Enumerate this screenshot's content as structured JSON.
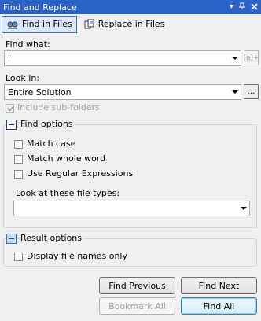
{
  "window": {
    "title": "Find and Replace"
  },
  "tabs": [
    {
      "label": "Find in Files"
    },
    {
      "label": "Replace in Files"
    }
  ],
  "find_what": {
    "label": "Find what:",
    "value": "i",
    "builder_label": "(a)+"
  },
  "look_in": {
    "label": "Look in:",
    "value": "Entire Solution",
    "browse_label": "..."
  },
  "include_subfolders": {
    "label": "Include sub-folders",
    "checked": true
  },
  "find_options": {
    "title": "Find options",
    "match_case": "Match case",
    "match_whole_word": "Match whole word",
    "use_regex": "Use Regular Expressions",
    "file_types_label": "Look at these file types:",
    "file_types_value": ""
  },
  "result_options": {
    "title": "Result options",
    "display_file_names_only": "Display file names only"
  },
  "buttons": {
    "find_previous": "Find Previous",
    "find_next": "Find Next",
    "bookmark_all": "Bookmark All",
    "find_all": "Find All"
  },
  "colors": {
    "titlebar": "#2b62c7",
    "active_tab": "#dce8fb",
    "accent": "#3d6fc4"
  }
}
